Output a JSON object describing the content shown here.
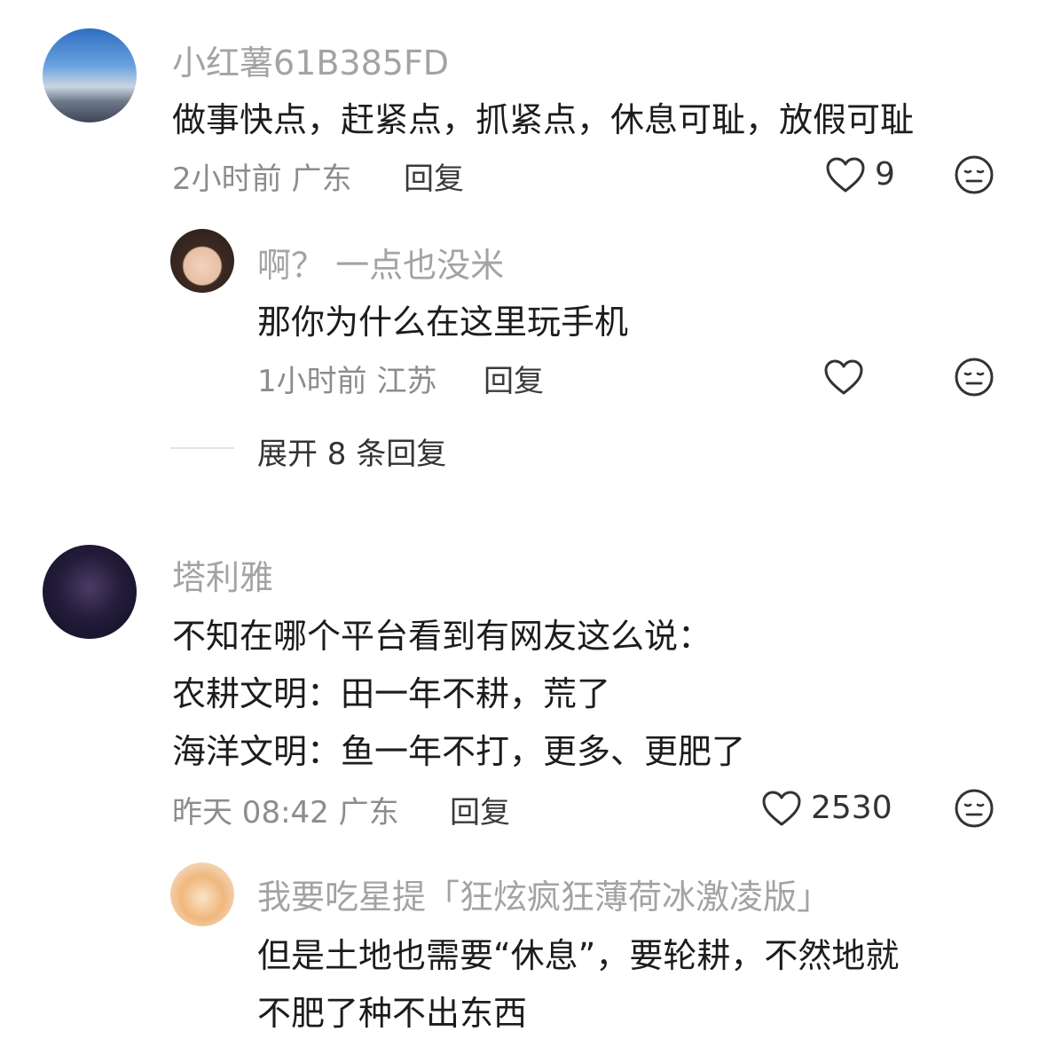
{
  "comments": [
    {
      "username": "小红薯61B385FD",
      "text": "做事快点，赶紧点，抓紧点，休息可耻，放假可耻",
      "meta": "2小时前 广东",
      "reply_label": "回复",
      "likes": "9",
      "reply": {
        "username": "啊？ 一点也没米",
        "text": "那你为什么在这里玩手机",
        "meta": "1小时前 江苏",
        "reply_label": "回复"
      },
      "expand_label": "展开 8 条回复"
    },
    {
      "username": "塔利雅",
      "text_lines": [
        "不知在哪个平台看到有网友这么说：",
        "农耕文明：田一年不耕，荒了",
        "海洋文明：鱼一年不打，更多、更肥了"
      ],
      "meta": "昨天 08:42 广东",
      "reply_label": "回复",
      "likes": "2530",
      "reply": {
        "username": "我要吃星提「狂炫疯狂薄荷冰激凌版」",
        "text_lines": [
          "但是土地也需要“休息”，要轮耕，不然地就",
          "不肥了种不出东西"
        ]
      }
    }
  ],
  "icons": {
    "like": "heart-outline-icon",
    "react": "expressionless-face-icon"
  }
}
